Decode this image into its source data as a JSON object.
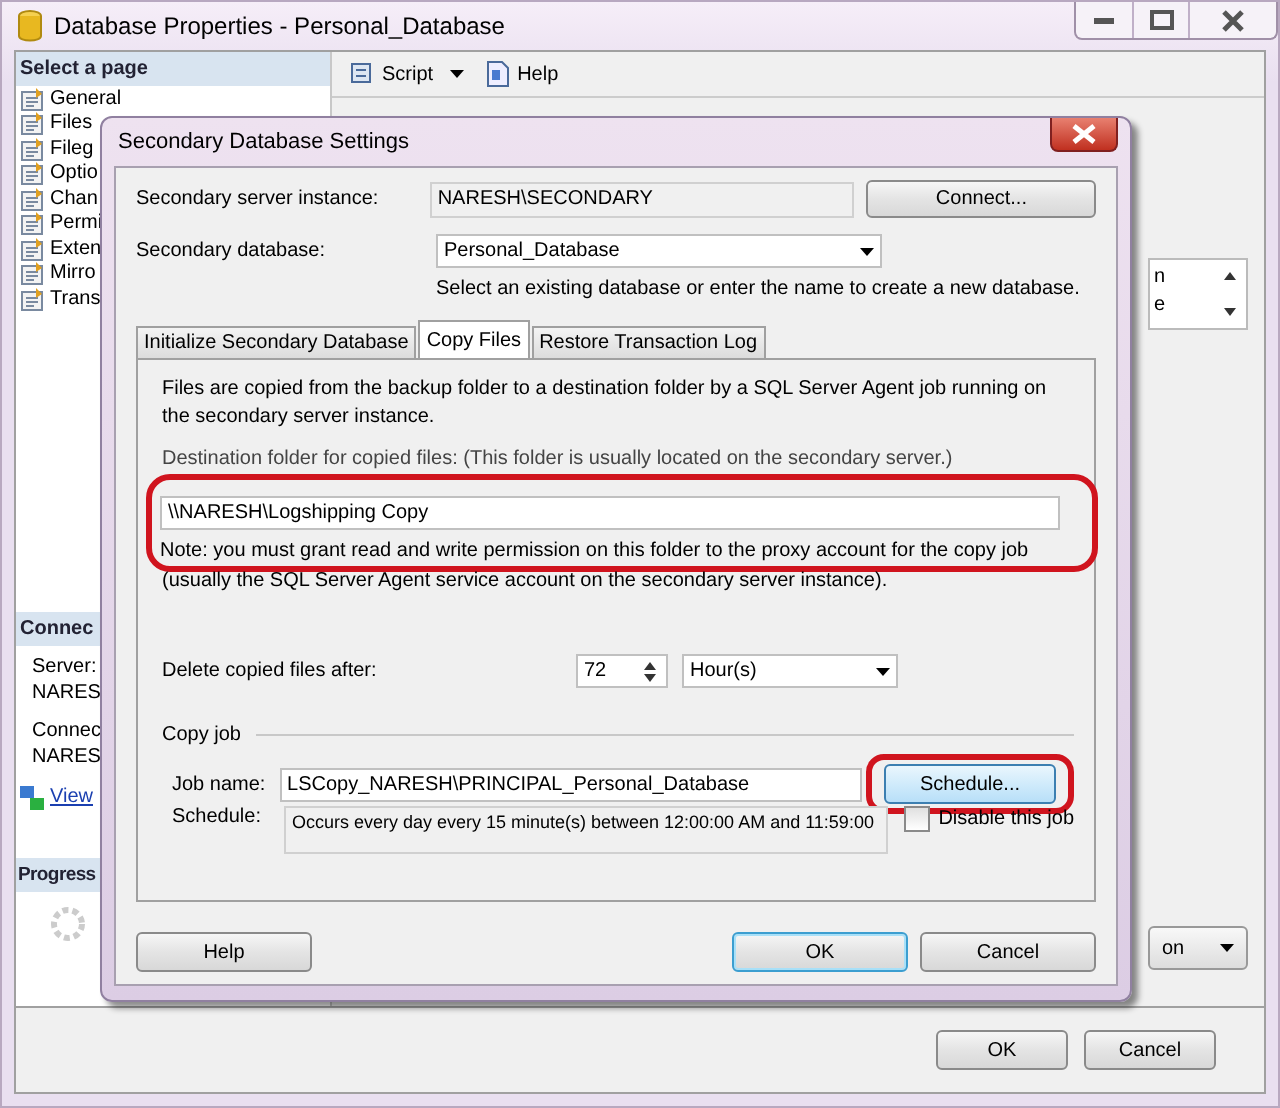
{
  "window": {
    "title": "Database Properties - Personal_Database"
  },
  "toolbar": [
    {
      "label": "Script",
      "kind": "script"
    },
    {
      "label": "Help",
      "kind": "help"
    }
  ],
  "sidebar": {
    "header": "Select a page",
    "pages": [
      {
        "label": "General"
      },
      {
        "label": "Files"
      },
      {
        "label": "Fileg"
      },
      {
        "label": "Optio"
      },
      {
        "label": "Chan"
      },
      {
        "label": "Permi"
      },
      {
        "label": "Exten"
      },
      {
        "label": "Mirro"
      },
      {
        "label": "Trans"
      }
    ],
    "connection_header": "Connec",
    "connection_fields": [
      {
        "label": "Server:",
        "value": "NARES"
      },
      {
        "label": "Connec",
        "value": "NARES"
      }
    ],
    "view_link": "View",
    "progress_header": "Progress"
  },
  "right_fragments": {
    "list_lines": [
      "n",
      "e"
    ],
    "dropdown_value": "on"
  },
  "footer_buttons": [
    {
      "label": "OK"
    },
    {
      "label": "Cancel"
    }
  ],
  "dialog": {
    "title": "Secondary Database Settings",
    "server_label": "Secondary server instance:",
    "server_value": "NARESH\\SECONDARY",
    "connect_button": "Connect...",
    "database_label": "Secondary database:",
    "database_value": "Personal_Database",
    "database_hint": "Select an existing database or enter the name to create a new database.",
    "tabs": [
      {
        "label": "Initialize Secondary Database",
        "selected": false
      },
      {
        "label": "Copy Files",
        "selected": true
      },
      {
        "label": "Restore Transaction Log",
        "selected": false
      }
    ],
    "copy_files": {
      "description": "Files are copied from the backup folder to a destination folder by a SQL Server Agent job running on the secondary server instance.",
      "destination_label": "Destination folder for copied files: (This folder is usually located on the secondary server.)",
      "destination_value": "\\\\NARESH\\Logshipping Copy",
      "destination_highlighted": true,
      "note": "Note: you must grant read and write permission on this folder to the proxy account for the copy job",
      "note_continued": "(usually the SQL Server Agent service account on the secondary server instance).",
      "delete_label": "Delete copied files after:",
      "delete_value": "72",
      "delete_unit": "Hour(s)",
      "group_title": "Copy job",
      "job_name_label": "Job name:",
      "job_name_value": "LSCopy_NARESH\\PRINCIPAL_Personal_Database",
      "schedule_label": "Schedule:",
      "schedule_value": "Occurs every day every 15 minute(s) between 12:00:00 AM and 11:59:00",
      "schedule_button": {
        "label": "Schedule...",
        "highlighted": true
      },
      "disable_job": {
        "label": "Disable this job",
        "checked": false
      }
    },
    "buttons": [
      {
        "label": "Help",
        "default": false
      },
      {
        "label": "OK",
        "default": true
      },
      {
        "label": "Cancel",
        "default": false
      }
    ]
  }
}
